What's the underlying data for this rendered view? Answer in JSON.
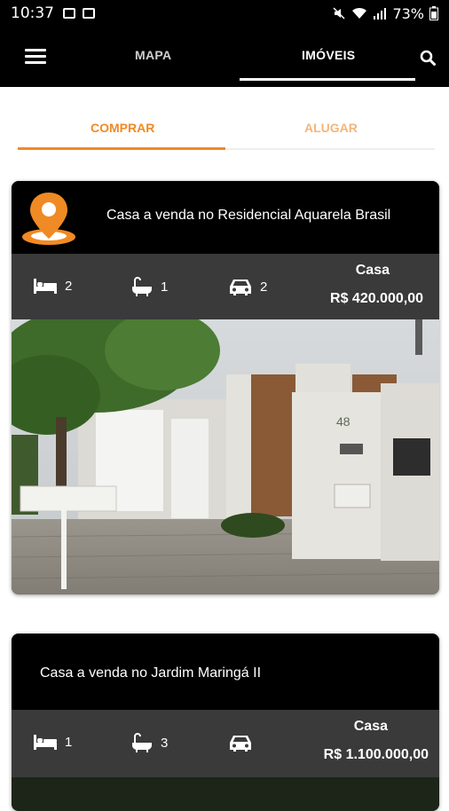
{
  "status_bar": {
    "time": "10:37",
    "battery": "73%"
  },
  "app_bar": {
    "menu_icon": "hamburger-icon",
    "tabs": [
      {
        "label": "MAPA"
      },
      {
        "label": "IMÓVEIS"
      }
    ],
    "search_icon": "search-icon"
  },
  "sub_tabs": [
    {
      "label": "COMPRAR"
    },
    {
      "label": "ALUGAR"
    }
  ],
  "colors": {
    "accent": "#f08a24",
    "card_bg": "#000000",
    "info_bg": "#3a3a3a"
  },
  "listings": [
    {
      "title": "Casa a venda no Residencial Aquarela Brasil",
      "bedrooms": "2",
      "bathrooms": "1",
      "garages": "2",
      "type": "Casa",
      "price": "R$ 420.000,00",
      "house_number": "48"
    },
    {
      "title": "Casa a venda no Jardim Maringá II",
      "bedrooms": "1",
      "bathrooms": "3",
      "garages": "",
      "type": "Casa",
      "price": "R$ 1.100.000,00"
    }
  ]
}
